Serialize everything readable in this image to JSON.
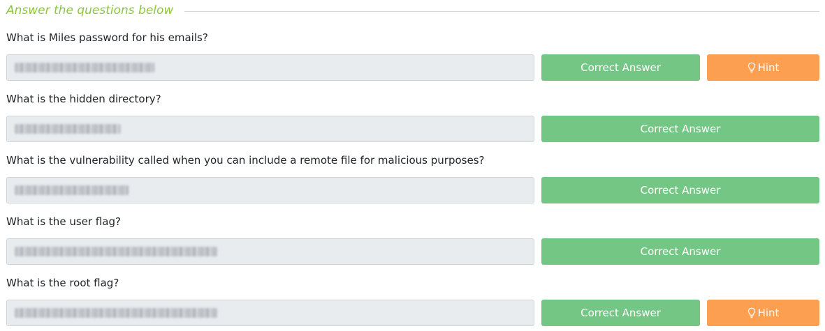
{
  "section": {
    "title": "Answer the questions below"
  },
  "questions": [
    {
      "label": "What is Miles password for his emails?",
      "answer_button": "Correct Answer",
      "hint_button": "Hint"
    },
    {
      "label": "What is the hidden directory?",
      "answer_button": "Correct Answer"
    },
    {
      "label": "What is the vulnerability called when you can include a remote file for malicious purposes?",
      "answer_button": "Correct Answer"
    },
    {
      "label": "What is the user flag?",
      "answer_button": "Correct Answer"
    },
    {
      "label": "What is the root flag?",
      "answer_button": "Correct Answer",
      "hint_button": "Hint"
    }
  ],
  "icons": {
    "hint": "lightbulb-icon"
  },
  "colors": {
    "section_title": "#8cc63f",
    "correct_button": "#74c685",
    "hint_button": "#fd9f51",
    "answer_field": "#e9ecef"
  }
}
